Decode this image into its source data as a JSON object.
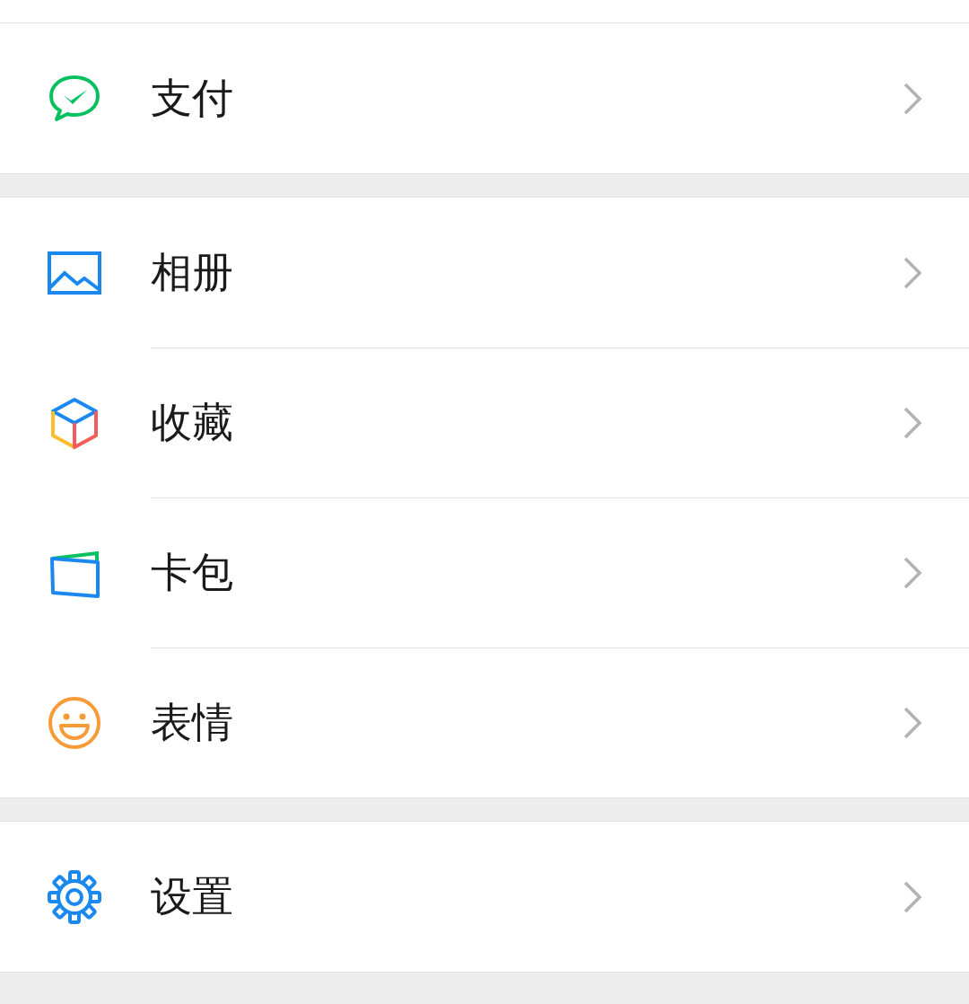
{
  "groups": [
    {
      "items": [
        {
          "kind": "pay",
          "label": "支付"
        }
      ]
    },
    {
      "items": [
        {
          "kind": "album",
          "label": "相册"
        },
        {
          "kind": "favorites",
          "label": "收藏"
        },
        {
          "kind": "cards",
          "label": "卡包"
        },
        {
          "kind": "stickers",
          "label": "表情"
        }
      ]
    },
    {
      "items": [
        {
          "kind": "settings",
          "label": "设置"
        }
      ]
    }
  ]
}
